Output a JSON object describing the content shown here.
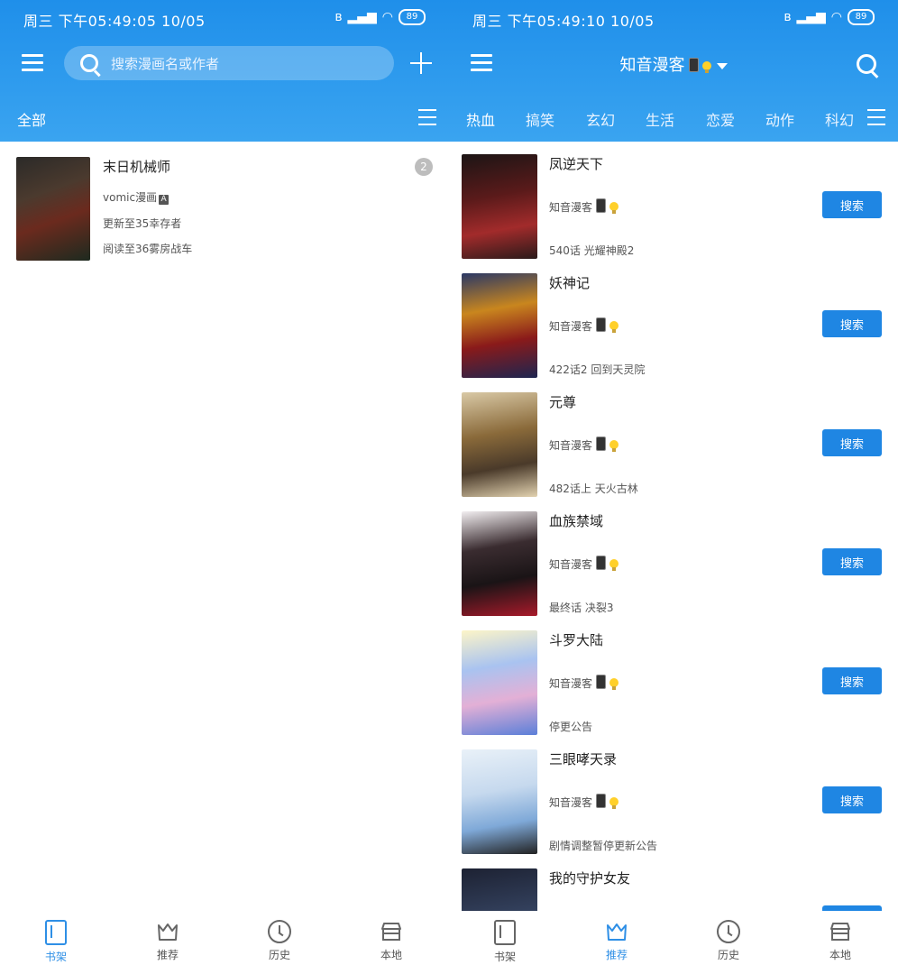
{
  "left": {
    "status": {
      "time": "周三 下午05:49:05 10/05",
      "battery": "89"
    },
    "search": {
      "placeholder": "搜索漫画名或作者"
    },
    "tabs": [
      {
        "label": "全部"
      }
    ],
    "bookshelf": [
      {
        "title": "末日机械师",
        "source": "vomic漫画",
        "source_badge": "A",
        "updated": "更新至35幸存者",
        "read": "阅读至36雾房战车",
        "count": "2"
      }
    ],
    "nav": [
      {
        "label": "书架"
      },
      {
        "label": "推荐"
      },
      {
        "label": "历史"
      },
      {
        "label": "本地"
      }
    ],
    "active_nav": "书架"
  },
  "right": {
    "status": {
      "time": "周三 下午05:49:10 10/05",
      "battery": "89"
    },
    "title": "知音漫客",
    "categories": [
      {
        "label": "热血"
      },
      {
        "label": "搞笑"
      },
      {
        "label": "玄幻"
      },
      {
        "label": "生活"
      },
      {
        "label": "恋爱"
      },
      {
        "label": "动作"
      },
      {
        "label": "科幻"
      }
    ],
    "items": [
      {
        "title": "凤逆天下",
        "source": "知音漫客",
        "chapter": "540话 光耀神殿2",
        "button": "搜索"
      },
      {
        "title": "妖神记",
        "source": "知音漫客",
        "chapter": "422话2 回到天灵院",
        "button": "搜索"
      },
      {
        "title": "元尊",
        "source": "知音漫客",
        "chapter": "482话上 天火古林",
        "button": "搜索"
      },
      {
        "title": "血族禁域",
        "source": "知音漫客",
        "chapter": "最终话 决裂3",
        "button": "搜索"
      },
      {
        "title": "斗罗大陆",
        "source": "知音漫客",
        "chapter": "停更公告",
        "button": "搜索"
      },
      {
        "title": "三眼哮天录",
        "source": "知音漫客",
        "chapter": "剧情调整暂停更新公告",
        "button": "搜索"
      },
      {
        "title": "我的守护女友",
        "source": "",
        "chapter": "",
        "button": "搜索"
      }
    ],
    "nav": [
      {
        "label": "书架"
      },
      {
        "label": "推荐"
      },
      {
        "label": "历史"
      },
      {
        "label": "本地"
      }
    ],
    "active_nav": "推荐"
  },
  "colors": {
    "accent": "#1f86e3",
    "header_top": "#1f8fea",
    "header_bottom": "#3aa4f0"
  }
}
